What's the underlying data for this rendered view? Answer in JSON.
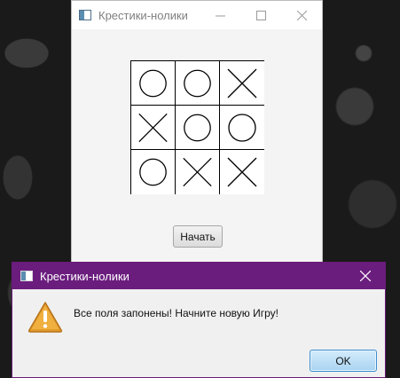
{
  "main_window": {
    "title": "Крестики-нолики",
    "start_button_label": "Начать",
    "board": [
      [
        "O",
        "O",
        "X"
      ],
      [
        "X",
        "O",
        "O"
      ],
      [
        "O",
        "X",
        "X"
      ]
    ]
  },
  "dialog": {
    "title": "Крестики-нолики",
    "message": "Все поля запонены! Начните новую Игру!",
    "ok_label": "OK",
    "icon": "warning-icon",
    "titlebar_color": "#6b1d7e"
  }
}
